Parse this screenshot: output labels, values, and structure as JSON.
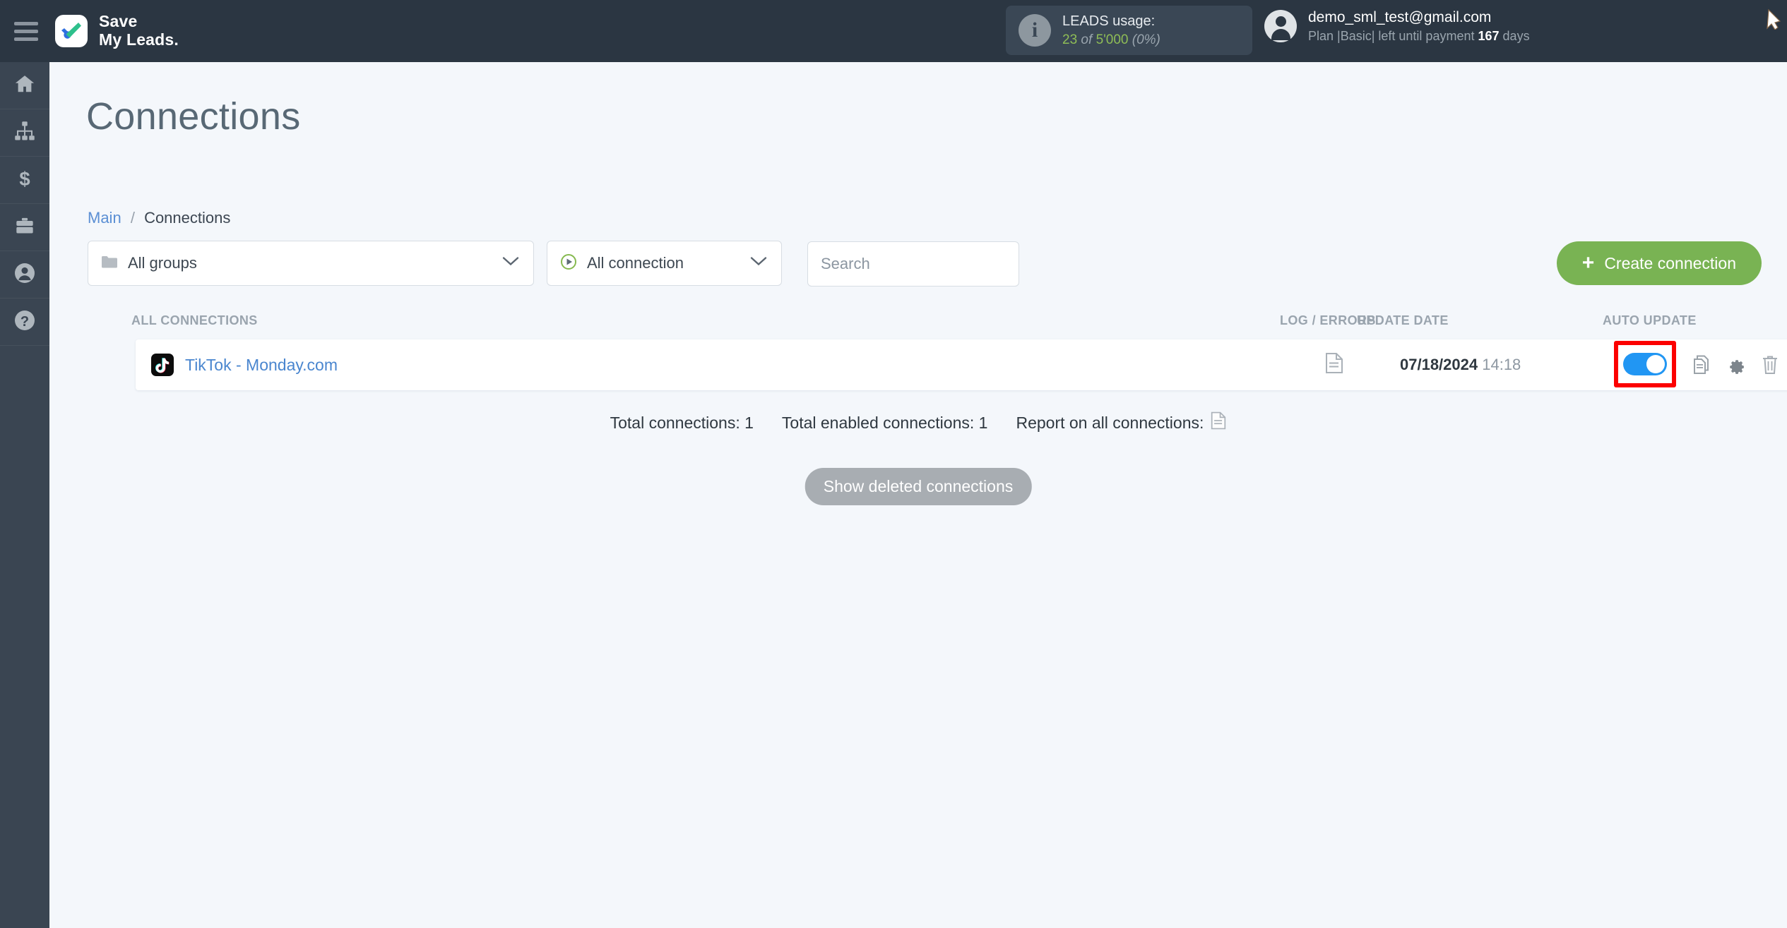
{
  "header": {
    "menu_icon": "hamburger-icon",
    "logo_line1": "Save",
    "logo_line2": "My Leads.",
    "leads": {
      "icon": "info-icon",
      "title": "LEADS usage:",
      "used": "23",
      "of": "of",
      "limit": "5'000",
      "percent": "(0%)"
    },
    "account": {
      "avatar_icon": "user-avatar-icon",
      "email": "demo_sml_test@gmail.com",
      "plan_prefix": "Plan |Basic| left until payment",
      "days_value": "167",
      "days_suffix": "days"
    }
  },
  "sidebar": {
    "items": [
      {
        "name": "home",
        "icon": "home-icon"
      },
      {
        "name": "connections",
        "icon": "sitemap-icon"
      },
      {
        "name": "billing",
        "icon": "dollar-icon"
      },
      {
        "name": "services",
        "icon": "briefcase-icon"
      },
      {
        "name": "profile",
        "icon": "user-icon"
      },
      {
        "name": "help",
        "icon": "question-circle-icon"
      }
    ]
  },
  "page": {
    "title": "Connections",
    "breadcrumb": {
      "root": "Main",
      "separator": "/",
      "current": "Connections"
    }
  },
  "filters": {
    "groups": {
      "label": "All groups",
      "icon": "folder-icon",
      "chevron": "chevron-down-icon"
    },
    "connection": {
      "label": "All connection",
      "icon": "play-circle-icon",
      "chevron": "chevron-down-icon"
    },
    "search": {
      "placeholder": "Search",
      "value": ""
    },
    "create_button": {
      "label": "Create connection",
      "plus": "+"
    }
  },
  "table": {
    "columns": {
      "name": "ALL CONNECTIONS",
      "log": "LOG / ERRORS",
      "date": "UPDATE DATE",
      "auto": "AUTO UPDATE"
    },
    "rows": [
      {
        "icon": "tiktok-icon",
        "name": "TikTok - Monday.com",
        "log_icon": "document-icon",
        "date": "07/18/2024",
        "time": "14:18",
        "auto_update": true,
        "actions": [
          "copy-icon",
          "gear-icon",
          "trash-icon"
        ]
      }
    ]
  },
  "footer": {
    "total_connections": "Total connections: 1",
    "total_enabled": "Total enabled connections: 1",
    "report_label": "Report on all connections:",
    "report_icon": "document-icon",
    "show_deleted": "Show deleted connections"
  },
  "colors": {
    "header_bg": "#2b3642",
    "sidebar_bg": "#3a4552",
    "page_bg": "#f4f7fb",
    "accent_green": "#79b353",
    "link_blue": "#4a86cf",
    "toggle_on": "#2196f3",
    "highlight_red": "#fc0000",
    "muted_gray": "#a8adb2"
  }
}
